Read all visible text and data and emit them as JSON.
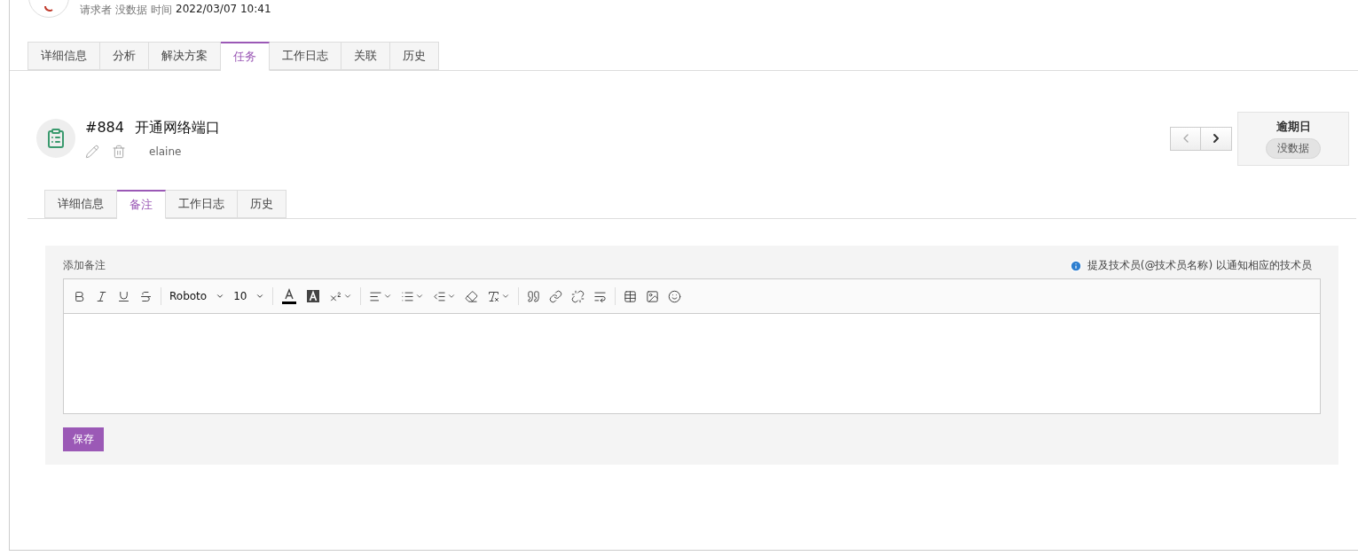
{
  "request": {
    "requester_label": "请求者",
    "requester": "没数据",
    "time_label": "时间",
    "time": "2022/03/07 10:41"
  },
  "tabs": [
    {
      "label": "详细信息",
      "selected": false
    },
    {
      "label": "分析",
      "selected": false
    },
    {
      "label": "解决方案",
      "selected": false
    },
    {
      "label": "任务",
      "selected": true
    },
    {
      "label": "工作日志",
      "selected": false
    },
    {
      "label": "关联",
      "selected": false
    },
    {
      "label": "历史",
      "selected": false
    }
  ],
  "task": {
    "number": "#884",
    "title": "开通网络端口",
    "owner": "elaine"
  },
  "overdue": {
    "label": "逾期日",
    "value": "没数据"
  },
  "task_tabs": [
    {
      "label": "详细信息",
      "selected": false
    },
    {
      "label": "备注",
      "selected": true
    },
    {
      "label": "工作日志",
      "selected": false
    },
    {
      "label": "历史",
      "selected": false
    }
  ],
  "note": {
    "label": "添加备注",
    "hint": "提及技术员(@技术员名称) 以通知相应的技术员",
    "font": "Roboto",
    "size": "10",
    "save": "保存"
  }
}
